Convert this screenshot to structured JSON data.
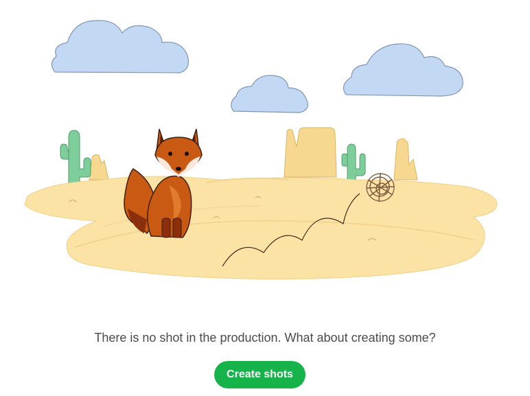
{
  "empty_state": {
    "message": "There is no shot in the production. What about creating some?",
    "button_label": "Create shots"
  },
  "illustration": {
    "subject": "fox-in-desert",
    "icons": [
      "cloud-icon",
      "cactus-icon",
      "mesa-rock-icon",
      "fox-icon",
      "tumbleweed-icon"
    ]
  },
  "colors": {
    "sky_cloud": "#c3d8f2",
    "sand": "#fbe3a6",
    "cactus": "#7dce9b",
    "fox": "#c85a14",
    "button": "#15b34a"
  }
}
